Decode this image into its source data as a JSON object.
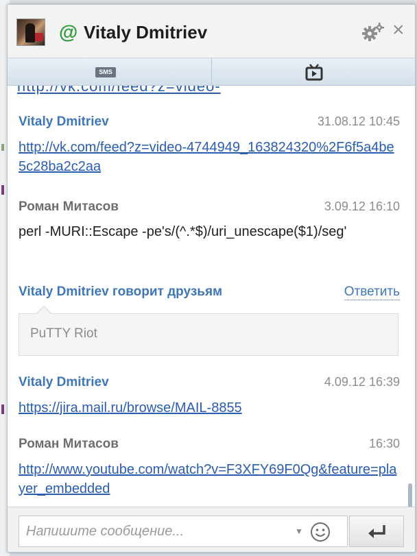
{
  "header": {
    "status_symbol": "@",
    "contact_name": "Vitaly Dmitriev",
    "status_color": "#2e9a36",
    "icons": [
      "avatar",
      "gear-icon",
      "close-icon"
    ],
    "close_symbol": "×"
  },
  "tabs": [
    {
      "name": "sms",
      "icon_label": "SMS"
    },
    {
      "name": "video",
      "icon": "tv-icon"
    }
  ],
  "messages": {
    "cut_link_text": "http://vk.com/feed?z=video-",
    "items": [
      {
        "author": "Vitaly Dmitriev",
        "time": "31.08.12 10:45",
        "link": "http://vk.com/feed?z=video-4744949_163824320%2F6f5a4be5c28ba2c2aa"
      },
      {
        "author": "Роман Митасов",
        "time": "3.09.12 16:10",
        "text": "perl -MURI::Escape -pe's/(^.*$)/uri_unescape($1)/seg'"
      },
      {
        "author": "Vitaly Dmitriev говорит друзьям",
        "reply_label": "Ответить",
        "quote": "PuTTY Riot"
      },
      {
        "author": "Vitaly Dmitriev",
        "time": "4.09.12 16:39",
        "link": "https://jira.mail.ru/browse/MAIL-8855"
      },
      {
        "author": "Роман Митасов",
        "time": "16:30",
        "link": "http://www.youtube.com/watch?v=F3XFY69F0Qg&feature=player_embedded"
      }
    ]
  },
  "input": {
    "placeholder": "Напишите сообщение...",
    "value": ""
  },
  "colors": {
    "link": "#2a5db0",
    "author_en": "#3e76b8",
    "author_ru": "#6e6e6e"
  }
}
